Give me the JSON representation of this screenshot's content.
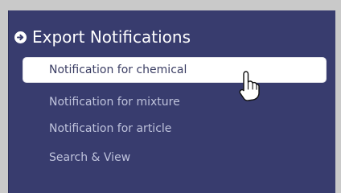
{
  "menu": {
    "heading": "Export Notifications",
    "heading_icon": "circle-arrow-right-icon",
    "items": [
      {
        "label": "Notification for chemical",
        "active": true
      },
      {
        "label": "Notification for mixture",
        "active": false
      },
      {
        "label": "Notification for article",
        "active": false
      },
      {
        "label": "Search & View",
        "active": false
      }
    ]
  },
  "cursor": {
    "icon": "hand-pointer-icon"
  },
  "colors": {
    "panel_background": "#383c6e",
    "frame_background": "#c9c9c9",
    "heading_text": "#ffffff",
    "item_text": "#bfc3dc",
    "active_background": "#ffffff",
    "active_text": "#3a3d63"
  }
}
